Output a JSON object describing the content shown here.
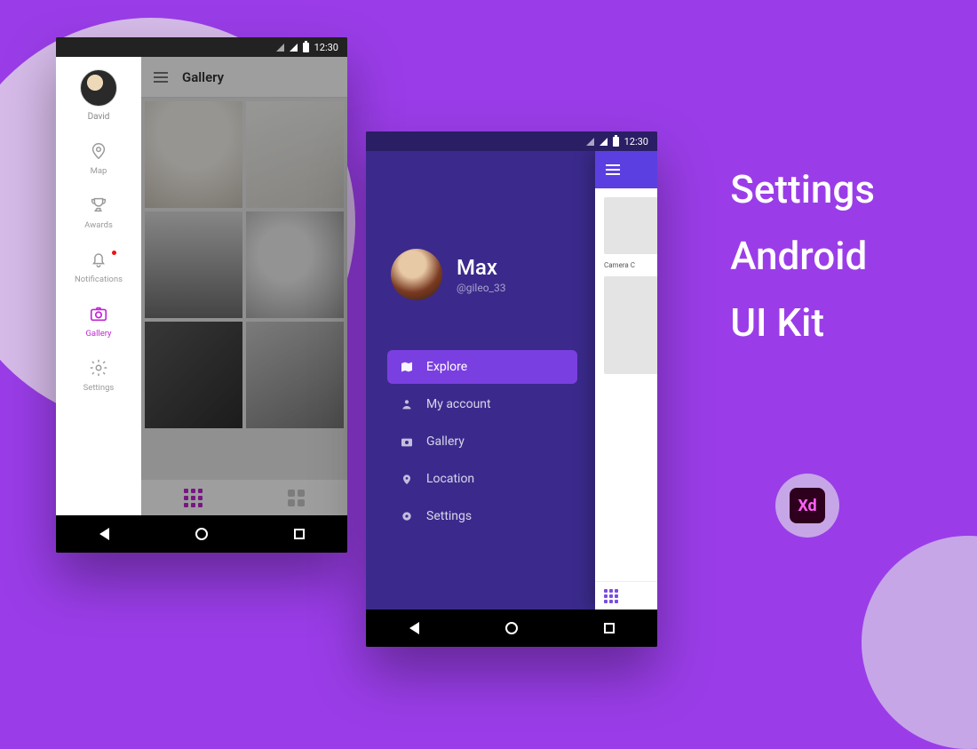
{
  "title": {
    "l1": "Settings",
    "l2": "Android",
    "l3": "UI Kit"
  },
  "badge": {
    "label": "Xd"
  },
  "status_time": "12:30",
  "phone1": {
    "screen_title": "Gallery",
    "user_name": "David",
    "drawer": [
      {
        "label": "Map"
      },
      {
        "label": "Awards"
      },
      {
        "label": "Notifications",
        "badge": true
      },
      {
        "label": "Gallery",
        "active": true
      },
      {
        "label": "Settings"
      }
    ]
  },
  "phone2": {
    "user_name": "Max",
    "user_handle": "@gileo_33",
    "peek_label": "Camera C",
    "menu": [
      {
        "label": "Explore",
        "active": true
      },
      {
        "label": "My account"
      },
      {
        "label": "Gallery"
      },
      {
        "label": "Location"
      },
      {
        "label": "Settings"
      }
    ]
  }
}
